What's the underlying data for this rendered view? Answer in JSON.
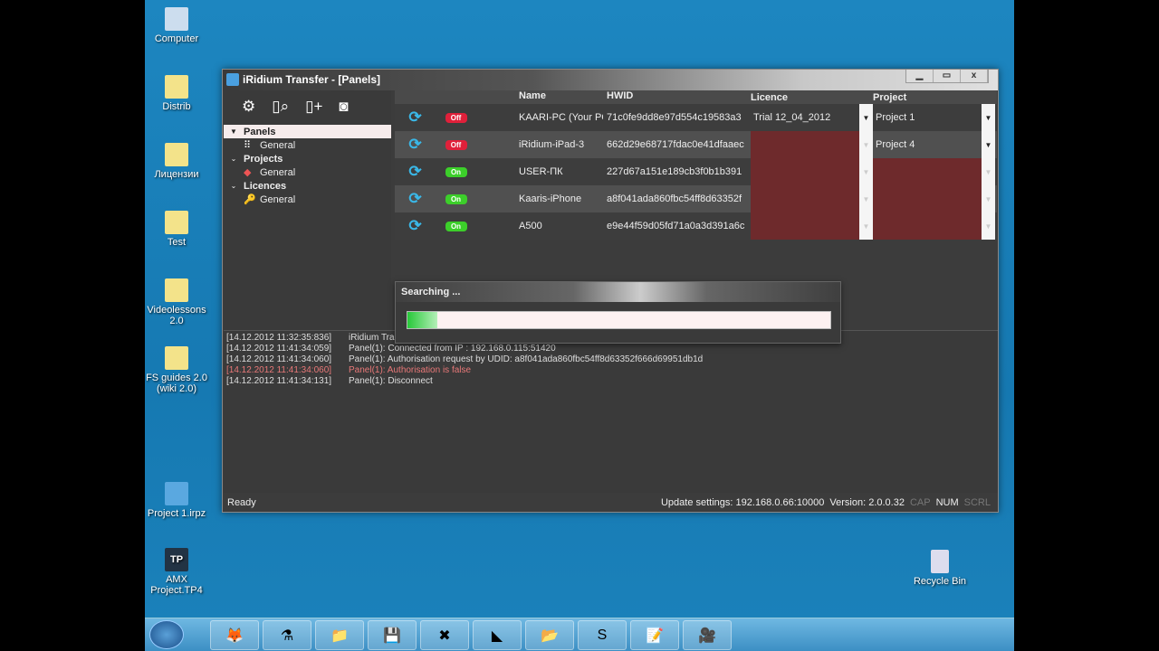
{
  "desktop": {
    "icons": [
      "Computer",
      "Distrib",
      "Лицензии",
      "Test",
      "Videolessons 2.0",
      "FS guides 2.0 (wiki 2.0)",
      "Project 1.irpz",
      "AMX Project.TP4",
      "Recycle Bin"
    ]
  },
  "window": {
    "title": "iRidium Transfer - [Panels]",
    "controls": [
      "▁",
      "▭",
      "x"
    ]
  },
  "toolbar": {
    "icons": [
      "settings-icon",
      "search-panel-icon",
      "add-panel-icon",
      "screenshot-icon"
    ]
  },
  "tree": [
    {
      "label": "Panels",
      "child": "General"
    },
    {
      "label": "Projects",
      "child": "General"
    },
    {
      "label": "Licences",
      "child": "General"
    }
  ],
  "grid": {
    "headers": [
      "",
      "",
      "",
      "Name",
      "HWID",
      "Licence",
      "Project"
    ],
    "rows": [
      {
        "state": "Off",
        "name": "KAARI-PC (Your PC)",
        "hwid": "71c0fe9dd8e97d554c19583a3",
        "licence": "Trial 12_04_2012",
        "project": "Project 1"
      },
      {
        "state": "Off",
        "name": "iRidium-iPad-3",
        "hwid": "662d29e68717fdac0e41dfaaec",
        "licence": "",
        "project": "Project 4"
      },
      {
        "state": "On",
        "name": "USER-ПК",
        "hwid": "227d67a151e189cb3f0b1b391",
        "licence": "",
        "project": ""
      },
      {
        "state": "On",
        "name": "Kaaris-iPhone",
        "hwid": "a8f041ada860fbc54ff8d63352f",
        "licence": "",
        "project": ""
      },
      {
        "state": "On",
        "name": "A500",
        "hwid": "e9e44f59d05fd71a0a3d391a6c",
        "licence": "",
        "project": ""
      }
    ]
  },
  "popup": {
    "title": "Searching ...",
    "progress": 0.07
  },
  "log": [
    {
      "time": "[14.12.2012 11:32:35:836]",
      "msg": "iRidium Transfer",
      "err": false
    },
    {
      "time": "[14.12.2012 11:41:34:059]",
      "msg": "Panel(1): Connected from IP : 192.168.0.115:51420",
      "err": false
    },
    {
      "time": "[14.12.2012 11:41:34:060]",
      "msg": "Panel(1): Authorisation request by UDID: a8f041ada860fbc54ff8d63352f666d69951db1d",
      "err": false
    },
    {
      "time": "[14.12.2012 11:41:34:060]",
      "msg": "Panel(1): Authorisation is false",
      "err": true
    },
    {
      "time": "[14.12.2012 11:41:34:131]",
      "msg": "Panel(1): Disconnect",
      "err": false
    }
  ],
  "status": {
    "left": "Ready",
    "update": "Update settings: 192.168.0.66:10000",
    "version": "Version: 2.0.0.32",
    "cap": "CAP",
    "num": "NUM",
    "scrl": "SCRL"
  }
}
